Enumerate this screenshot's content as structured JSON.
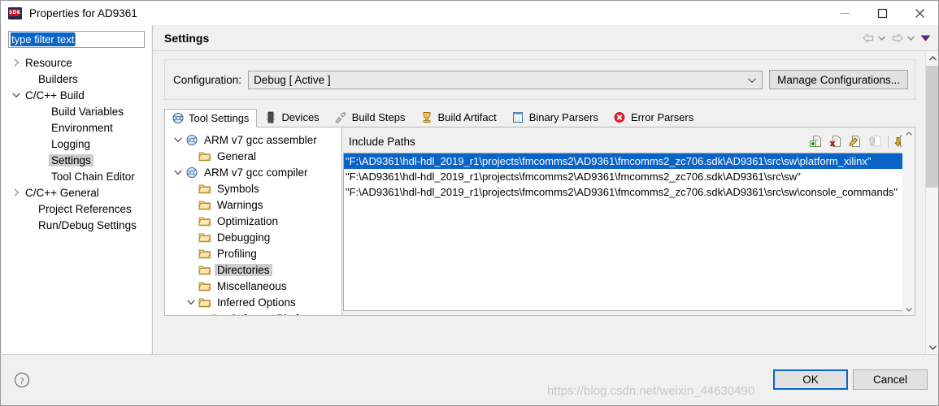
{
  "window": {
    "title": "Properties for AD9361",
    "app_icon": "sdk-icon",
    "icon_text": "SDK",
    "minimize": "–",
    "maximize": "□",
    "close": "✕"
  },
  "filter": {
    "value": "type filter text",
    "placeholder": "type filter text"
  },
  "nav_tree": [
    {
      "label": "Resource",
      "indent": 0,
      "arrow": "collapsed",
      "selected": false
    },
    {
      "label": "Builders",
      "indent": 1,
      "arrow": "none",
      "selected": false
    },
    {
      "label": "C/C++ Build",
      "indent": 0,
      "arrow": "expanded",
      "selected": false
    },
    {
      "label": "Build Variables",
      "indent": 2,
      "arrow": "none",
      "selected": false
    },
    {
      "label": "Environment",
      "indent": 2,
      "arrow": "none",
      "selected": false
    },
    {
      "label": "Logging",
      "indent": 2,
      "arrow": "none",
      "selected": false
    },
    {
      "label": "Settings",
      "indent": 2,
      "arrow": "none",
      "selected": true
    },
    {
      "label": "Tool Chain Editor",
      "indent": 2,
      "arrow": "none",
      "selected": false
    },
    {
      "label": "C/C++ General",
      "indent": 0,
      "arrow": "collapsed",
      "selected": false
    },
    {
      "label": "Project References",
      "indent": 1,
      "arrow": "none",
      "selected": false
    },
    {
      "label": "Run/Debug Settings",
      "indent": 1,
      "arrow": "none",
      "selected": false
    }
  ],
  "page": {
    "title": "Settings",
    "nav": {
      "back_icon": "back-arrow-icon",
      "back_menu_icon": "chevron-down-icon",
      "forward_icon": "forward-arrow-icon",
      "forward_menu_icon": "chevron-down-icon",
      "view_menu_icon": "chevron-down-icon"
    }
  },
  "configuration": {
    "label": "Configuration:",
    "value": "Debug  [ Active ]",
    "dropdown_icon": "chevron-down-icon",
    "manage_button": "Manage Configurations..."
  },
  "tabs": [
    {
      "label": "Tool Settings",
      "icon": "tool-settings-icon",
      "active": true
    },
    {
      "label": "Devices",
      "icon": "devices-icon",
      "active": false
    },
    {
      "label": "Build Steps",
      "icon": "build-steps-icon",
      "active": false
    },
    {
      "label": "Build Artifact",
      "icon": "build-artifact-icon",
      "active": false
    },
    {
      "label": "Binary Parsers",
      "icon": "binary-parsers-icon",
      "active": false
    },
    {
      "label": "Error Parsers",
      "icon": "error-parsers-icon",
      "active": false
    }
  ],
  "tool_tree": [
    {
      "label": "ARM v7 gcc assembler",
      "indent": 0,
      "arrow": "expanded",
      "icon": "tool-icon",
      "selected": false
    },
    {
      "label": "General",
      "indent": 1,
      "arrow": "none",
      "icon": "folder-icon",
      "selected": false
    },
    {
      "label": "ARM v7 gcc compiler",
      "indent": 0,
      "arrow": "expanded",
      "icon": "tool-icon",
      "selected": false
    },
    {
      "label": "Symbols",
      "indent": 1,
      "arrow": "none",
      "icon": "folder-icon",
      "selected": false
    },
    {
      "label": "Warnings",
      "indent": 1,
      "arrow": "none",
      "icon": "folder-icon",
      "selected": false
    },
    {
      "label": "Optimization",
      "indent": 1,
      "arrow": "none",
      "icon": "folder-icon",
      "selected": false
    },
    {
      "label": "Debugging",
      "indent": 1,
      "arrow": "none",
      "icon": "folder-icon",
      "selected": false
    },
    {
      "label": "Profiling",
      "indent": 1,
      "arrow": "none",
      "icon": "folder-icon",
      "selected": false
    },
    {
      "label": "Directories",
      "indent": 1,
      "arrow": "none",
      "icon": "folder-icon",
      "selected": true
    },
    {
      "label": "Miscellaneous",
      "indent": 1,
      "arrow": "none",
      "icon": "folder-icon",
      "selected": false
    },
    {
      "label": "Inferred Options",
      "indent": 1,
      "arrow": "expanded",
      "icon": "folder-icon",
      "selected": false
    },
    {
      "label": "Software Platform",
      "indent": 2,
      "arrow": "none",
      "icon": "folder-icon",
      "selected": false
    }
  ],
  "include_paths": {
    "title": "Include Paths",
    "toolbar": [
      {
        "name": "add-path-icon",
        "hint": "add",
        "enabled": true
      },
      {
        "name": "delete-path-icon",
        "hint": "delete",
        "enabled": true
      },
      {
        "name": "edit-path-icon",
        "hint": "edit",
        "enabled": true
      },
      {
        "name": "move-up-icon",
        "hint": "move up",
        "enabled": false
      },
      {
        "name": "move-down-icon",
        "hint": "move down",
        "enabled": true
      }
    ],
    "items": [
      {
        "value": "\"F:\\AD9361\\hdl-hdl_2019_r1\\projects\\fmcomms2\\AD9361\\fmcomms2_zc706.sdk\\AD9361\\src\\sw\\platform_xilinx\"",
        "selected": true
      },
      {
        "value": "\"F:\\AD9361\\hdl-hdl_2019_r1\\projects\\fmcomms2\\AD9361\\fmcomms2_zc706.sdk\\AD9361\\src\\sw\"",
        "selected": false
      },
      {
        "value": "\"F:\\AD9361\\hdl-hdl_2019_r1\\projects\\fmcomms2\\AD9361\\fmcomms2_zc706.sdk\\AD9361\\src\\sw\\console_commands\"",
        "selected": false
      }
    ]
  },
  "footer": {
    "help_icon": "help-icon",
    "ok": "OK",
    "cancel": "Cancel"
  },
  "watermark": "https://blog.csdn.net/weixin_44630490",
  "colors": {
    "selection_blue": "#0a64c8",
    "tree_selection_grey": "#cdcdcd",
    "dialog_bg": "#f0f0f0",
    "accent_focus": "#0a64c8"
  }
}
